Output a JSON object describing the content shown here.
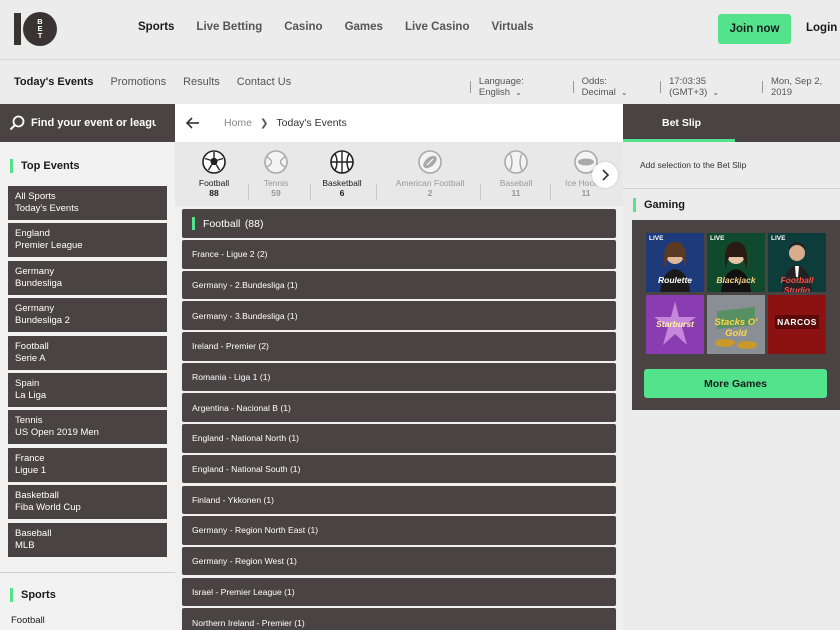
{
  "brand": {
    "logo_text": "10 BET",
    "accent": "#54e38d",
    "panel": "#4a4344"
  },
  "nav": {
    "items": [
      "Sports",
      "Live Betting",
      "Casino",
      "Games",
      "Live Casino",
      "Virtuals"
    ],
    "active": "Sports"
  },
  "header": {
    "join_label": "Join now",
    "login_label": "Login"
  },
  "subnav": {
    "items": [
      "Today's Events",
      "Promotions",
      "Results",
      "Contact Us"
    ],
    "active": "Today's Events"
  },
  "settings": {
    "language_label": "Language:",
    "language_value": "English",
    "odds_label": "Odds:",
    "odds_value": "Decimal",
    "time": "17:03:35",
    "timezone": "(GMT+3)",
    "date": "Mon, Sep 2, 2019"
  },
  "left": {
    "search_placeholder": "Find your event or league",
    "top_events_title": "Top Events",
    "top_events": [
      {
        "line1": "All Sports",
        "line2": "Today's Events"
      },
      {
        "line1": "England",
        "line2": "Premier League"
      },
      {
        "line1": "Germany",
        "line2": "Bundesliga"
      },
      {
        "line1": "Germany",
        "line2": "Bundesliga 2"
      },
      {
        "line1": "Football",
        "line2": "Serie A"
      },
      {
        "line1": "Spain",
        "line2": "La Liga"
      },
      {
        "line1": "Tennis",
        "line2": "US Open 2019 Men"
      },
      {
        "line1": "France",
        "line2": "Ligue 1"
      },
      {
        "line1": "Basketball",
        "line2": "Fiba World Cup"
      },
      {
        "line1": "Baseball",
        "line2": "MLB"
      }
    ],
    "sports_title": "Sports",
    "sports_first": "Football"
  },
  "breadcrumb": {
    "home": "Home",
    "current": "Today's Events"
  },
  "sports": [
    {
      "name": "Football",
      "count": "88",
      "active": true,
      "icon": "football-icon"
    },
    {
      "name": "Tennis",
      "count": "59",
      "active": false,
      "icon": "tennis-icon"
    },
    {
      "name": "Basketball",
      "count": "6",
      "active": true,
      "icon": "basketball-icon"
    },
    {
      "name": "American Football",
      "count": "2",
      "active": false,
      "icon": "american-football-icon"
    },
    {
      "name": "Baseball",
      "count": "11",
      "active": false,
      "icon": "baseball-icon"
    },
    {
      "name": "Ice Hockey",
      "count": "11",
      "active": false,
      "icon": "ice-hockey-icon"
    }
  ],
  "competition_header": {
    "name": "Football",
    "count": "(88)"
  },
  "competitions": [
    "France - Ligue 2 (2)",
    "Germany - 2.Bundesliga (1)",
    "Germany - 3.Bundesliga (1)",
    "Ireland - Premier (2)",
    "Romania - Liga 1 (1)",
    "Argentina - Nacional B (1)",
    "England - National North (1)",
    "England - National South (1)",
    "Finland - Ykkonen (1)",
    "Germany - Region North East (1)",
    "Germany - Region West (1)",
    "Israel - Premier League (1)",
    "Northern Ireland - Premier (1)"
  ],
  "betslip": {
    "title": "Bet Slip",
    "empty_message": "Add selection to the Bet Slip"
  },
  "gaming": {
    "title": "Gaming",
    "games": [
      {
        "name": "Roulette",
        "live": "LIVE"
      },
      {
        "name": "Blackjack",
        "live": "LIVE"
      },
      {
        "name": "Football Studio",
        "live": "LIVE"
      },
      {
        "name": "Starburst",
        "live": ""
      },
      {
        "name": "Stacks O' Gold",
        "live": ""
      },
      {
        "name": "NARCOS",
        "live": ""
      }
    ],
    "more_label": "More Games"
  }
}
